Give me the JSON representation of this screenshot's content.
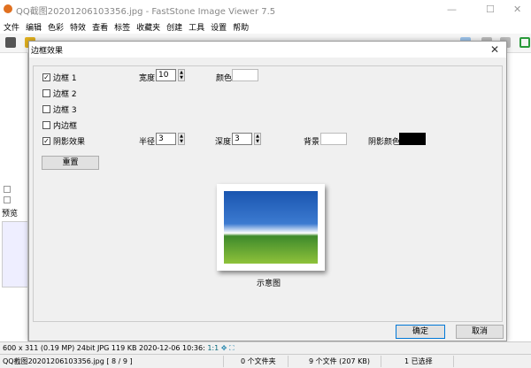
{
  "window": {
    "title": "QQ截图20201206103356.jpg  -  FastStone Image Viewer 7.5",
    "minimize": "—",
    "maximize": "☐",
    "close": "✕"
  },
  "menu": [
    "文件",
    "编辑",
    "色彩",
    "特效",
    "查看",
    "标签",
    "收藏夹",
    "创建",
    "工具",
    "设置",
    "帮助"
  ],
  "left_pane": {
    "preview_label": "预览"
  },
  "dialog": {
    "title": "边框效果",
    "close": "✕",
    "border1": {
      "label": "边框 1",
      "checked": true
    },
    "border2": {
      "label": "边框 2",
      "checked": false
    },
    "border3": {
      "label": "边框 3",
      "checked": false
    },
    "inner_border": {
      "label": "内边框",
      "checked": false
    },
    "shadow": {
      "label": "阴影效果",
      "checked": true
    },
    "width_label": "宽度:",
    "width_value": "10",
    "color_label": "颜色:",
    "color_value": "#ffffff",
    "radius_label": "半径:",
    "radius_value": "3",
    "depth_label": "深度:",
    "depth_value": "3",
    "background_label": "背景:",
    "background_value": "#ffffff",
    "shadow_color_label": "阴影颜色:",
    "shadow_color_value": "#000000",
    "reset": "重置",
    "preview_caption": "示意图",
    "ok": "确定",
    "cancel": "取消"
  },
  "info": {
    "dimensions": "600 x 311 (0.19 MP)",
    "depth": "24bit",
    "format": "JPG",
    "size": "119 KB",
    "date": "2020-12-06 10:36:",
    "zoom": "1:1"
  },
  "status": {
    "file": "QQ截图20201206103356.jpg [ 8 / 9 ]",
    "folders": "0 个文件夹",
    "files": "9 个文件 (207 KB)",
    "selected": "1 已选择"
  }
}
